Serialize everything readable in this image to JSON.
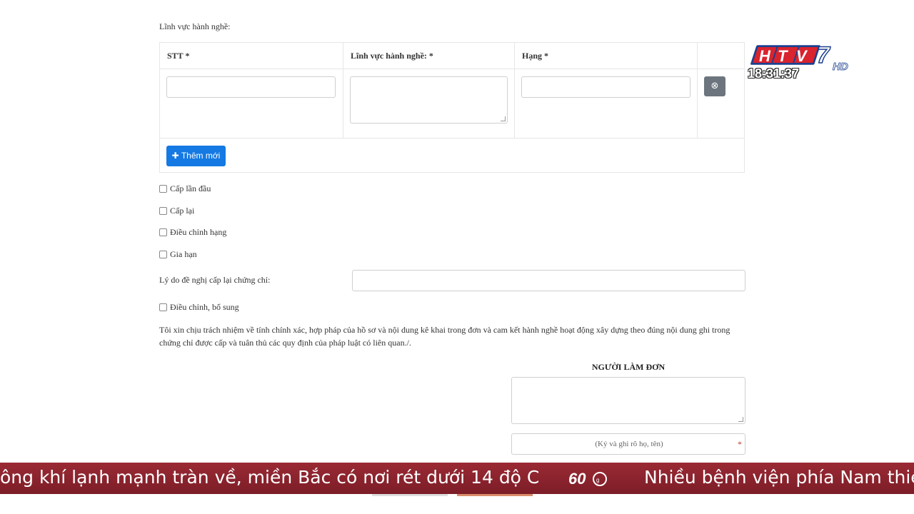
{
  "section_label": "Lĩnh vực hành nghề:",
  "table": {
    "headers": [
      "STT *",
      "Lĩnh vực hành nghề: *",
      "Hạng *",
      ""
    ],
    "delete_icon": "⊗",
    "add_button": "✚ Thêm mới"
  },
  "checkboxes": [
    "Cấp lần đầu",
    "Cấp lại",
    "Điều chỉnh hạng",
    "Gia hạn"
  ],
  "reason_label": "Lý do đề nghị cấp lại chứng chỉ:",
  "adjust_checkbox": "Điều chỉnh, bổ sung",
  "declaration": "Tôi xin chịu trách nhiệm về tính chính xác, hợp pháp của hồ sơ và nội dung kê khai trong đơn và cam kết hành nghề hoạt động xây dựng theo đúng nội dung ghi trong chứng chỉ được cấp và tuân thủ các quy định của pháp luật có liên quan./.",
  "applicant": {
    "title": "NGƯỜI LÀM ĐƠN",
    "sign_placeholder": "(Ký và ghi rõ họ, tên)",
    "required_mark": "*"
  },
  "overlay": {
    "channel_logo": "HTV7 HD",
    "clock": "18:31:37",
    "ticker_left": "ông khí lạnh mạnh tràn về, miền Bắc có nơi rét dưới 14 độ C",
    "ticker_right": "Nhiều bệnh viện phía Nam thiế"
  },
  "colors": {
    "primary_button": "#1479e3",
    "delete_button": "#6c757d",
    "ticker_bg": "#8a2430"
  }
}
